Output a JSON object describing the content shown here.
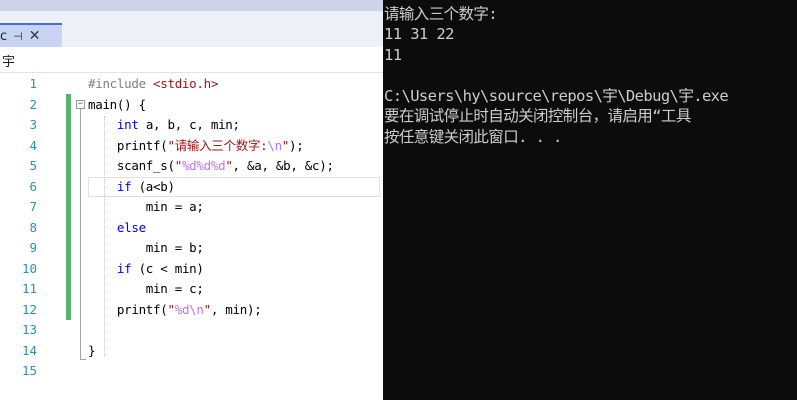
{
  "editor": {
    "tab": {
      "name": "c",
      "pin_icon": "pin-icon",
      "close_icon": "close-icon"
    },
    "nav": {
      "crumb": "宇"
    },
    "lines": [
      {
        "num": "1",
        "code": "#include <stdio.h>"
      },
      {
        "num": "2",
        "code": "main() {"
      },
      {
        "num": "3",
        "code": "    int a, b, c, min;"
      },
      {
        "num": "4",
        "code": "    printf(\"请输入三个数字:\\n\");"
      },
      {
        "num": "5",
        "code": "    scanf_s(\"%d%d%d\", &a, &b, &c);"
      },
      {
        "num": "6",
        "code": "    if (a<b)"
      },
      {
        "num": "7",
        "code": "        min = a;"
      },
      {
        "num": "8",
        "code": "    else"
      },
      {
        "num": "9",
        "code": "        min = b;"
      },
      {
        "num": "10",
        "code": "    if (c < min)"
      },
      {
        "num": "11",
        "code": "        min = c;"
      },
      {
        "num": "12",
        "code": "    printf(\"%d\\n\", min);"
      },
      {
        "num": "13",
        "code": ""
      },
      {
        "num": "14",
        "code": "}"
      },
      {
        "num": "15",
        "code": ""
      }
    ]
  },
  "console": {
    "lines": [
      "请输入三个数字:",
      "11 31 22",
      "11",
      "",
      "C:\\Users\\hy\\source\\repos\\宇\\Debug\\宇.exe",
      "要在调试停止时自动关闭控制台，请启用“工具",
      "按任意键关闭此窗口. . ."
    ]
  },
  "colors": {
    "keyword": "#0000ff",
    "preprocessor": "#808080",
    "string": "#a31515",
    "escape": "#b776fb",
    "line_number": "#2b91af",
    "change_bar": "#57b46d",
    "console_bg": "#0c0c0c",
    "console_text": "#cccccc"
  }
}
